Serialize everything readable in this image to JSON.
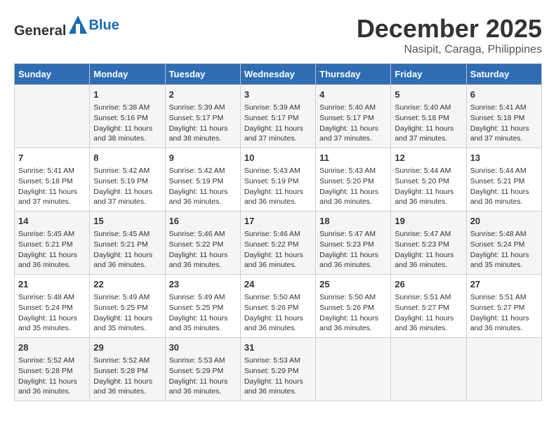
{
  "header": {
    "logo_general": "General",
    "logo_blue": "Blue",
    "month": "December 2025",
    "location": "Nasipit, Caraga, Philippines"
  },
  "weekdays": [
    "Sunday",
    "Monday",
    "Tuesday",
    "Wednesday",
    "Thursday",
    "Friday",
    "Saturday"
  ],
  "weeks": [
    [
      {
        "day": "",
        "info": ""
      },
      {
        "day": "1",
        "info": "Sunrise: 5:38 AM\nSunset: 5:16 PM\nDaylight: 11 hours\nand 38 minutes."
      },
      {
        "day": "2",
        "info": "Sunrise: 5:39 AM\nSunset: 5:17 PM\nDaylight: 11 hours\nand 38 minutes."
      },
      {
        "day": "3",
        "info": "Sunrise: 5:39 AM\nSunset: 5:17 PM\nDaylight: 11 hours\nand 37 minutes."
      },
      {
        "day": "4",
        "info": "Sunrise: 5:40 AM\nSunset: 5:17 PM\nDaylight: 11 hours\nand 37 minutes."
      },
      {
        "day": "5",
        "info": "Sunrise: 5:40 AM\nSunset: 5:18 PM\nDaylight: 11 hours\nand 37 minutes."
      },
      {
        "day": "6",
        "info": "Sunrise: 5:41 AM\nSunset: 5:18 PM\nDaylight: 11 hours\nand 37 minutes."
      }
    ],
    [
      {
        "day": "7",
        "info": "Sunrise: 5:41 AM\nSunset: 5:18 PM\nDaylight: 11 hours\nand 37 minutes."
      },
      {
        "day": "8",
        "info": "Sunrise: 5:42 AM\nSunset: 5:19 PM\nDaylight: 11 hours\nand 37 minutes."
      },
      {
        "day": "9",
        "info": "Sunrise: 5:42 AM\nSunset: 5:19 PM\nDaylight: 11 hours\nand 36 minutes."
      },
      {
        "day": "10",
        "info": "Sunrise: 5:43 AM\nSunset: 5:19 PM\nDaylight: 11 hours\nand 36 minutes."
      },
      {
        "day": "11",
        "info": "Sunrise: 5:43 AM\nSunset: 5:20 PM\nDaylight: 11 hours\nand 36 minutes."
      },
      {
        "day": "12",
        "info": "Sunrise: 5:44 AM\nSunset: 5:20 PM\nDaylight: 11 hours\nand 36 minutes."
      },
      {
        "day": "13",
        "info": "Sunrise: 5:44 AM\nSunset: 5:21 PM\nDaylight: 11 hours\nand 36 minutes."
      }
    ],
    [
      {
        "day": "14",
        "info": "Sunrise: 5:45 AM\nSunset: 5:21 PM\nDaylight: 11 hours\nand 36 minutes."
      },
      {
        "day": "15",
        "info": "Sunrise: 5:45 AM\nSunset: 5:21 PM\nDaylight: 11 hours\nand 36 minutes."
      },
      {
        "day": "16",
        "info": "Sunrise: 5:46 AM\nSunset: 5:22 PM\nDaylight: 11 hours\nand 36 minutes."
      },
      {
        "day": "17",
        "info": "Sunrise: 5:46 AM\nSunset: 5:22 PM\nDaylight: 11 hours\nand 36 minutes."
      },
      {
        "day": "18",
        "info": "Sunrise: 5:47 AM\nSunset: 5:23 PM\nDaylight: 11 hours\nand 36 minutes."
      },
      {
        "day": "19",
        "info": "Sunrise: 5:47 AM\nSunset: 5:23 PM\nDaylight: 11 hours\nand 36 minutes."
      },
      {
        "day": "20",
        "info": "Sunrise: 5:48 AM\nSunset: 5:24 PM\nDaylight: 11 hours\nand 35 minutes."
      }
    ],
    [
      {
        "day": "21",
        "info": "Sunrise: 5:48 AM\nSunset: 5:24 PM\nDaylight: 11 hours\nand 35 minutes."
      },
      {
        "day": "22",
        "info": "Sunrise: 5:49 AM\nSunset: 5:25 PM\nDaylight: 11 hours\nand 35 minutes."
      },
      {
        "day": "23",
        "info": "Sunrise: 5:49 AM\nSunset: 5:25 PM\nDaylight: 11 hours\nand 35 minutes."
      },
      {
        "day": "24",
        "info": "Sunrise: 5:50 AM\nSunset: 5:26 PM\nDaylight: 11 hours\nand 36 minutes."
      },
      {
        "day": "25",
        "info": "Sunrise: 5:50 AM\nSunset: 5:26 PM\nDaylight: 11 hours\nand 36 minutes."
      },
      {
        "day": "26",
        "info": "Sunrise: 5:51 AM\nSunset: 5:27 PM\nDaylight: 11 hours\nand 36 minutes."
      },
      {
        "day": "27",
        "info": "Sunrise: 5:51 AM\nSunset: 5:27 PM\nDaylight: 11 hours\nand 36 minutes."
      }
    ],
    [
      {
        "day": "28",
        "info": "Sunrise: 5:52 AM\nSunset: 5:28 PM\nDaylight: 11 hours\nand 36 minutes."
      },
      {
        "day": "29",
        "info": "Sunrise: 5:52 AM\nSunset: 5:28 PM\nDaylight: 11 hours\nand 36 minutes."
      },
      {
        "day": "30",
        "info": "Sunrise: 5:53 AM\nSunset: 5:29 PM\nDaylight: 11 hours\nand 36 minutes."
      },
      {
        "day": "31",
        "info": "Sunrise: 5:53 AM\nSunset: 5:29 PM\nDaylight: 11 hours\nand 36 minutes."
      },
      {
        "day": "",
        "info": ""
      },
      {
        "day": "",
        "info": ""
      },
      {
        "day": "",
        "info": ""
      }
    ]
  ]
}
